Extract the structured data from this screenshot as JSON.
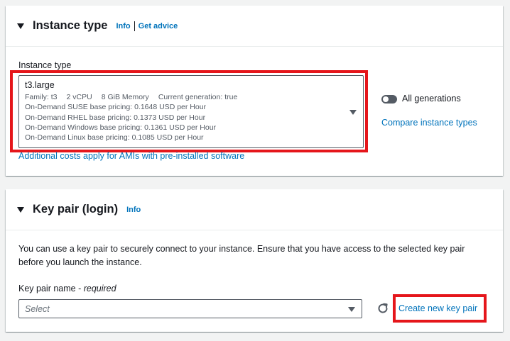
{
  "instance_panel": {
    "title": "Instance type",
    "info": "Info",
    "get_advice": "Get advice",
    "field_label": "Instance type",
    "selected": {
      "name": "t3.large",
      "family": "Family: t3",
      "vcpu": "2 vCPU",
      "memory": "8 GiB Memory",
      "generation": "Current generation: true",
      "pricing": [
        "On-Demand SUSE base pricing: 0.1648 USD per Hour",
        "On-Demand RHEL base pricing: 0.1373 USD per Hour",
        "On-Demand Windows base pricing: 0.1361 USD per Hour",
        "On-Demand Linux base pricing: 0.1085 USD per Hour"
      ]
    },
    "additional_costs": "Additional costs apply for AMIs with pre-installed software",
    "all_generations_label": "All generations",
    "all_generations_on": false,
    "compare_link": "Compare instance types"
  },
  "keypair_panel": {
    "title": "Key pair (login)",
    "info": "Info",
    "description": "You can use a key pair to securely connect to your instance. Ensure that you have access to the selected key pair before you launch the instance.",
    "field_label": "Key pair name",
    "required": "required",
    "placeholder": "Select",
    "create_link": "Create new key pair"
  },
  "colors": {
    "link": "#0073bb",
    "highlight": "#e5161b",
    "text": "#16191f",
    "muted": "#545b64",
    "background": "#f2f3f3"
  },
  "icons": {
    "collapse": "caret-down-icon",
    "dropdown": "caret-down-icon",
    "refresh": "refresh-icon"
  }
}
